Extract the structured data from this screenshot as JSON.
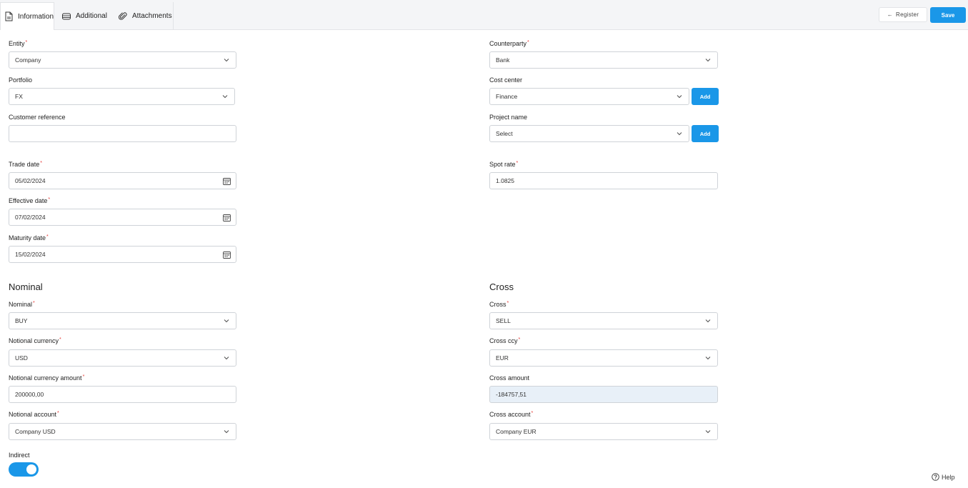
{
  "tabs": [
    {
      "label": "Information",
      "icon": "document-icon"
    },
    {
      "label": "Additional",
      "icon": "stack-icon"
    },
    {
      "label": "Attachments",
      "icon": "paperclip-icon"
    }
  ],
  "header": {
    "register_label": "Register",
    "save_label": "Save"
  },
  "left": {
    "entity": {
      "label": "Entity",
      "value": "Company"
    },
    "portfolio": {
      "label": "Portfolio",
      "value": "FX"
    },
    "customer_reference": {
      "label": "Customer reference",
      "value": ""
    },
    "trade_date": {
      "label": "Trade date",
      "value": "05/02/2024"
    },
    "effective_date": {
      "label": "Effective date",
      "value": "07/02/2024"
    },
    "maturity_date": {
      "label": "Maturity date",
      "value": "15/02/2024"
    }
  },
  "right": {
    "counterparty": {
      "label": "Counterparty",
      "value": "Bank"
    },
    "cost_center": {
      "label": "Cost center",
      "value": "Finance",
      "add_label": "Add"
    },
    "project_name": {
      "label": "Project name",
      "value": "Select",
      "add_label": "Add"
    },
    "spot_rate": {
      "label": "Spot rate",
      "value": "1.0825"
    }
  },
  "nominal": {
    "title": "Nominal",
    "nominal": {
      "label": "Nominal",
      "value": "BUY"
    },
    "notional_currency": {
      "label": "Notional currency",
      "value": "USD"
    },
    "notional_currency_amount": {
      "label": "Notional currency amount",
      "value": "200000,00"
    },
    "notional_account": {
      "label": "Notional account",
      "value": "Company USD"
    },
    "indirect": {
      "label": "Indirect",
      "enabled": true
    }
  },
  "cross": {
    "title": "Cross",
    "cross": {
      "label": "Cross",
      "value": "SELL"
    },
    "cross_ccy": {
      "label": "Cross ccy",
      "value": "EUR"
    },
    "cross_amount": {
      "label": "Cross amount",
      "value": "-184757,51"
    },
    "cross_account": {
      "label": "Cross account",
      "value": "Company EUR"
    }
  },
  "help_label": "Help",
  "colors": {
    "accent": "#1a97e8",
    "required": "#e53935",
    "readonly_bg": "#e8f0f8"
  }
}
